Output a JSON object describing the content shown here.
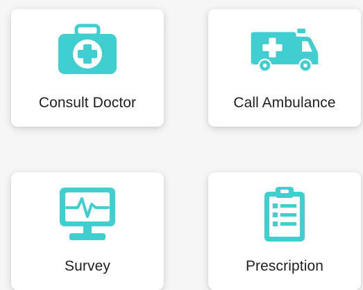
{
  "accent_color": "#3fcfd0",
  "cards": [
    {
      "label": "Consult Doctor",
      "icon": "medical-kit-icon"
    },
    {
      "label": "Call Ambulance",
      "icon": "ambulance-icon"
    },
    {
      "label": "Survey",
      "icon": "heart-monitor-icon"
    },
    {
      "label": "Prescription",
      "icon": "clipboard-icon"
    }
  ]
}
